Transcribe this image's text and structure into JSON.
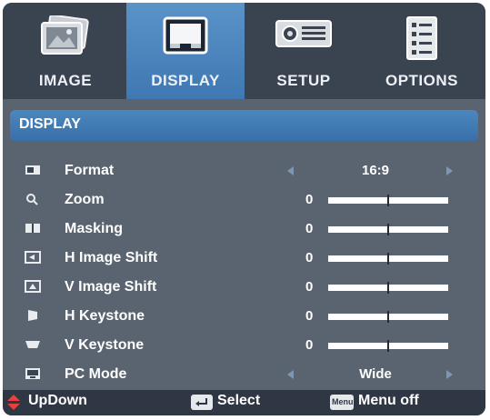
{
  "tabs": [
    {
      "label": "IMAGE",
      "icon": "image-picture-icon",
      "active": false
    },
    {
      "label": "DISPLAY",
      "icon": "display-screen-icon",
      "active": true
    },
    {
      "label": "SETUP",
      "icon": "projector-setup-icon",
      "active": false
    },
    {
      "label": "OPTIONS",
      "icon": "options-list-icon",
      "active": false
    }
  ],
  "section": {
    "title": "DISPLAY"
  },
  "rows": [
    {
      "label": "Format",
      "text_value": "16:9",
      "icon": "format-aspect-icon"
    },
    {
      "label": "Zoom",
      "value": "0",
      "level": 0.5,
      "icon": "zoom-magnifier-icon"
    },
    {
      "label": "Masking",
      "value": "0",
      "level": 0.5,
      "icon": "masking-icon"
    },
    {
      "label": "H Image Shift",
      "value": "0",
      "level": 0.5,
      "icon": "h-image-shift-icon"
    },
    {
      "label": "V Image Shift",
      "value": "0",
      "level": 0.5,
      "icon": "v-image-shift-icon"
    },
    {
      "label": "H Keystone",
      "value": "0",
      "level": 0.5,
      "icon": "h-keystone-icon"
    },
    {
      "label": "V Keystone",
      "value": "0",
      "level": 0.5,
      "icon": "v-keystone-icon"
    },
    {
      "label": "PC Mode",
      "text_value": "Wide",
      "icon": "pc-mode-icon"
    }
  ],
  "footer": {
    "updown": "UpDown",
    "select": "Select",
    "menu_off": "Menu off",
    "menu_key_label": "Menu"
  },
  "colors": {
    "active_tab": "#4a86c0",
    "panel": "#5a6370",
    "tab_bar": "#3a4350",
    "footer": "#2f3744",
    "arrow": "#7e96b6",
    "updown": "#e8403a"
  }
}
